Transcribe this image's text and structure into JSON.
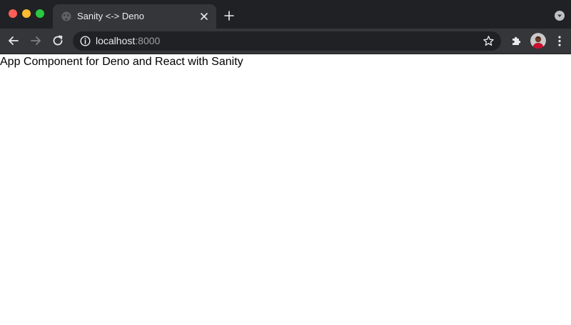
{
  "window": {
    "traffic_lights": {
      "close": "#ff5f57",
      "minimize": "#febc2e",
      "zoom": "#28c840"
    }
  },
  "tabs": [
    {
      "title": "Sanity <-> Deno",
      "favicon": "globe-icon",
      "active": true
    }
  ],
  "new_tab": {
    "icon": "plus-icon"
  },
  "toolbar": {
    "back_icon": "arrow-left-icon",
    "forward_icon": "arrow-right-icon",
    "reload_icon": "reload-icon",
    "extensions_icon": "puzzle-icon",
    "menu_icon": "kebab-menu-icon"
  },
  "omnibox": {
    "security_icon": "info-icon",
    "host": "localhost",
    "port": ":8000",
    "bookmark_icon": "star-icon"
  },
  "page": {
    "text": "App Component for Deno and React with Sanity"
  }
}
